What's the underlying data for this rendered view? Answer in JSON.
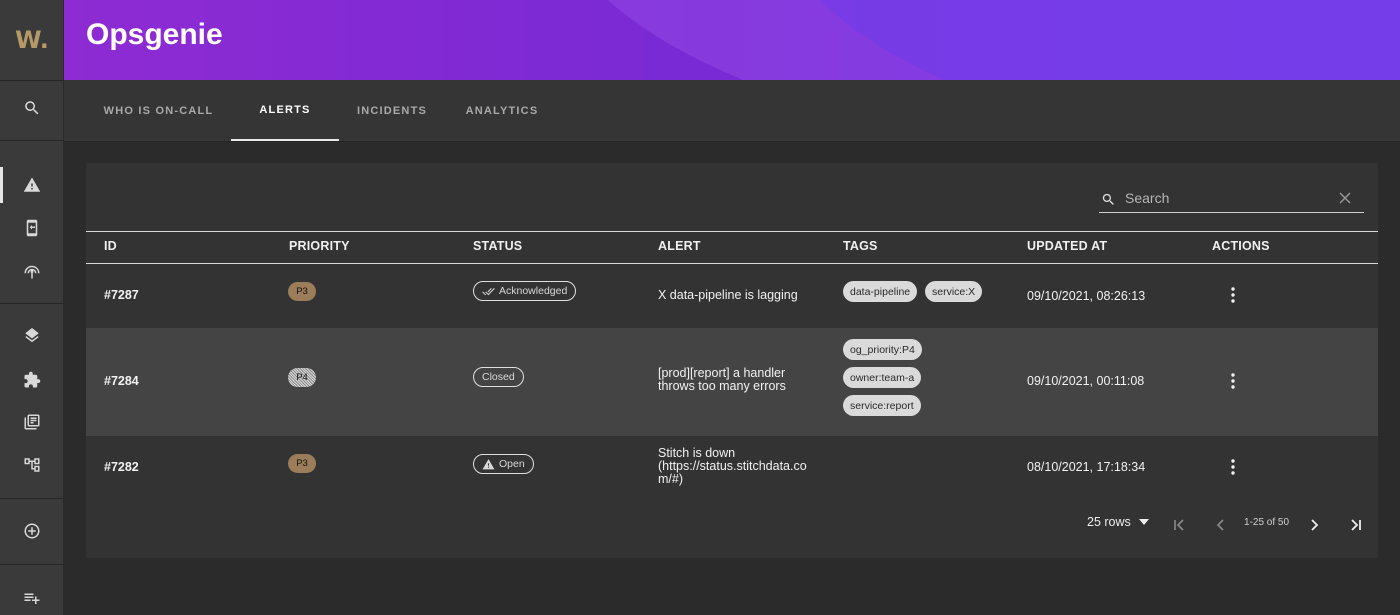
{
  "app": {
    "logo": "W.",
    "title": "Opsgenie"
  },
  "sidebar": {
    "items": [
      {
        "name": "search-icon"
      },
      {
        "name": "alert-triangle-icon",
        "active": true
      },
      {
        "name": "phone-icon"
      },
      {
        "name": "broadcast-icon"
      },
      {
        "name": "layers-icon"
      },
      {
        "name": "puzzle-icon"
      },
      {
        "name": "library-icon"
      },
      {
        "name": "hierarchy-icon"
      },
      {
        "name": "add-circle-icon"
      },
      {
        "name": "playlist-add-icon"
      }
    ]
  },
  "tabs": [
    {
      "label": "WHO IS ON-CALL",
      "active": false
    },
    {
      "label": "ALERTS",
      "active": true
    },
    {
      "label": "INCIDENTS",
      "active": false
    },
    {
      "label": "ANALYTICS",
      "active": false
    }
  ],
  "search": {
    "placeholder": "Search",
    "value": ""
  },
  "table": {
    "columns": [
      "ID",
      "PRIORITY",
      "STATUS",
      "ALERT",
      "TAGS",
      "UPDATED AT",
      "ACTIONS"
    ],
    "rows": [
      {
        "id": "#7287",
        "priority": "P3",
        "status": "Acknowledged",
        "status_icon": "double-check-icon",
        "alert_lines": [
          "X data-pipeline is lagging"
        ],
        "tags": [
          "data-pipeline",
          "service:X"
        ],
        "updated_at": "09/10/2021, 08:26:13"
      },
      {
        "id": "#7284",
        "priority": "P4",
        "status": "Closed",
        "status_icon": "",
        "alert_lines": [
          "[prod][report] a handler",
          "throws too many errors"
        ],
        "tags": [
          "og_priority:P4",
          "owner:team-a",
          "service:report"
        ],
        "updated_at": "09/10/2021, 00:11:08"
      },
      {
        "id": "#7282",
        "priority": "P3",
        "status": "Open",
        "status_icon": "warning-icon",
        "alert_lines": [
          "Stitch is down",
          "(https://status.stitchdata.co",
          "m/#)"
        ],
        "tags": [],
        "updated_at": "08/10/2021, 17:18:34"
      }
    ]
  },
  "pagination": {
    "rows_per_page": "25 rows",
    "range": "1-25 of 50"
  },
  "colors": {
    "header_gradient_start": "#8e2bd3",
    "header_gradient_end": "#6c2fe3",
    "priority_p3": "#9b7d59",
    "logo": "#b59a68"
  }
}
